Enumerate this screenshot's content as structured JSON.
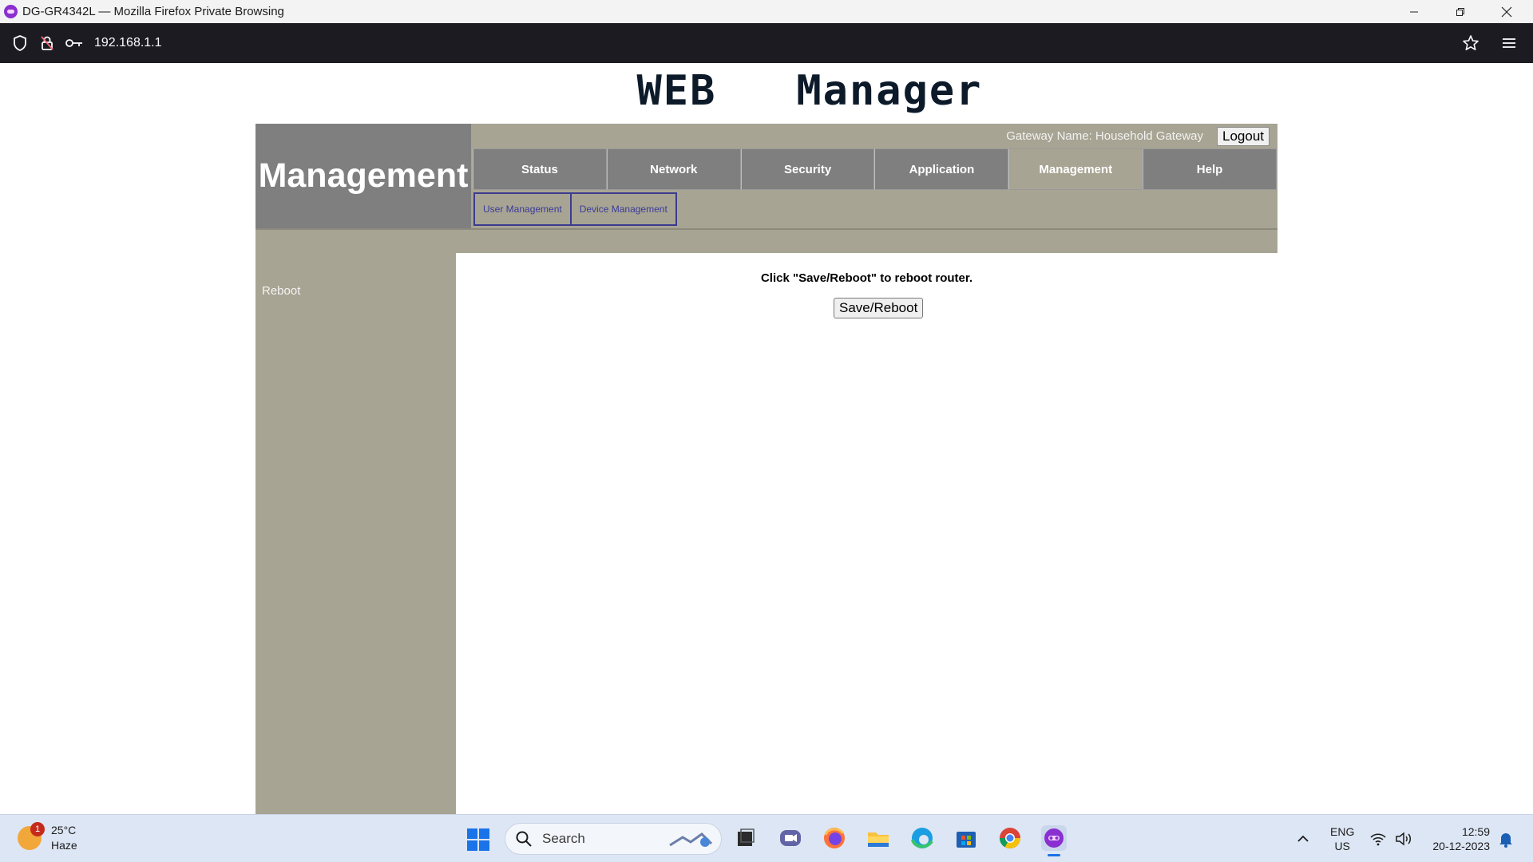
{
  "window": {
    "title": "DG-GR4342L — Mozilla Firefox Private Browsing"
  },
  "browser": {
    "url": "192.168.1.1"
  },
  "router": {
    "banner": "WEB   Manager",
    "section_title": "Management",
    "gateway_label": "Gateway Name: Household Gateway",
    "logout_label": "Logout",
    "tabs": [
      {
        "label": "Status"
      },
      {
        "label": "Network"
      },
      {
        "label": "Security"
      },
      {
        "label": "Application"
      },
      {
        "label": "Management",
        "active": true
      },
      {
        "label": "Help"
      }
    ],
    "subtabs": [
      {
        "label": "User Management"
      },
      {
        "label": "Device Management"
      }
    ],
    "sidebar_items": [
      {
        "label": "Reboot"
      }
    ],
    "instruction": "Click \"Save/Reboot\" to reboot router.",
    "save_reboot_label": "Save/Reboot"
  },
  "taskbar": {
    "weather_temp": "25°C",
    "weather_desc": "Haze",
    "weather_badge": "1",
    "search_label": "Search",
    "lang_line1": "ENG",
    "lang_line2": "US",
    "time": "12:59",
    "date": "20-12-2023"
  },
  "colors": {
    "header_gray": "#7f7f7f",
    "khaki": "#a8a493",
    "sub_tab_text": "#3a3a9a"
  }
}
